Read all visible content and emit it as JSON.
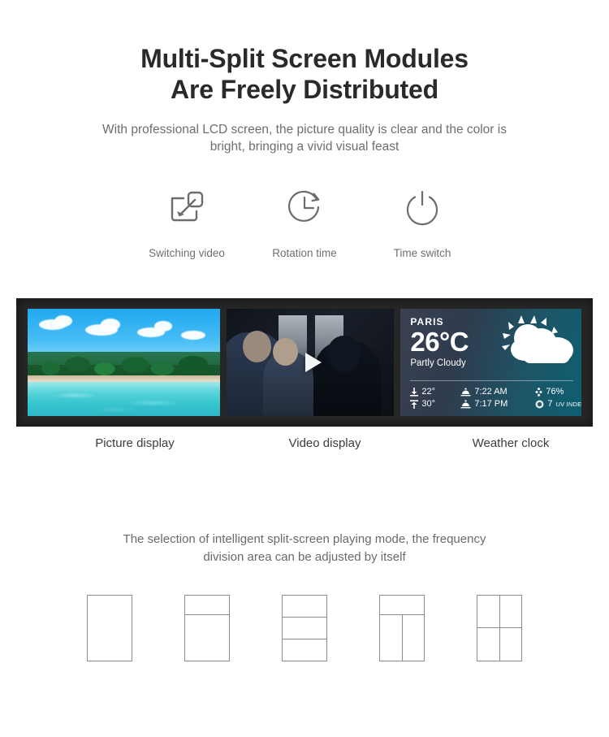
{
  "header": {
    "title_line1": "Multi-Split Screen Modules",
    "title_line2": "Are Freely Distributed",
    "subtitle_line1": "With professional LCD screen, the picture quality is clear and the color is",
    "subtitle_line2": "bright, bringing a vivid visual feast"
  },
  "features": [
    {
      "icon": "switching-video-icon",
      "label": "Switching video"
    },
    {
      "icon": "rotation-time-icon",
      "label": "Rotation time"
    },
    {
      "icon": "time-switch-icon",
      "label": "Time switch"
    }
  ],
  "display": {
    "panels": [
      {
        "name": "picture-display",
        "label": "Picture display"
      },
      {
        "name": "video-display",
        "label": "Video display"
      },
      {
        "name": "weather-clock",
        "label": "Weather clock"
      }
    ],
    "video": {
      "play_icon": "play-icon"
    },
    "weather": {
      "city": "PARIS",
      "temperature": "26°C",
      "condition": "Partly Cloudy",
      "weather_icon": "sun-behind-cloud-icon",
      "stats": [
        {
          "icon": "temp-low-icon",
          "value": "22°"
        },
        {
          "icon": "sunrise-icon",
          "value": "7:22 AM"
        },
        {
          "icon": "humidity-icon",
          "value": "76%"
        },
        {
          "icon": "temp-high-icon",
          "value": "30°"
        },
        {
          "icon": "sunset-icon",
          "value": "7:17 PM"
        },
        {
          "icon": "uv-icon",
          "value": "7",
          "suffix": "UV INDEX"
        }
      ]
    }
  },
  "bottom": {
    "caption_line1": "The selection of intelligent split-screen playing mode, the frequency",
    "caption_line2": "division area can be adjusted by itself",
    "layouts": [
      {
        "name": "layout-single",
        "rows": [
          1
        ]
      },
      {
        "name": "layout-two-rows",
        "rows": [
          1,
          1
        ]
      },
      {
        "name": "layout-three-rows",
        "rows": [
          1,
          1,
          1
        ]
      },
      {
        "name": "layout-top-plus-two-cols",
        "rows": [
          1,
          2
        ]
      },
      {
        "name": "layout-quad",
        "rows": [
          2,
          2
        ]
      }
    ]
  },
  "colors": {
    "title": "#2a2a2a",
    "body_text": "#6e6e6e",
    "bezel": "#262626",
    "weather_gradient_start": "#3a4152",
    "weather_gradient_end": "#0d5f72",
    "layout_border": "#8c8c8c"
  }
}
